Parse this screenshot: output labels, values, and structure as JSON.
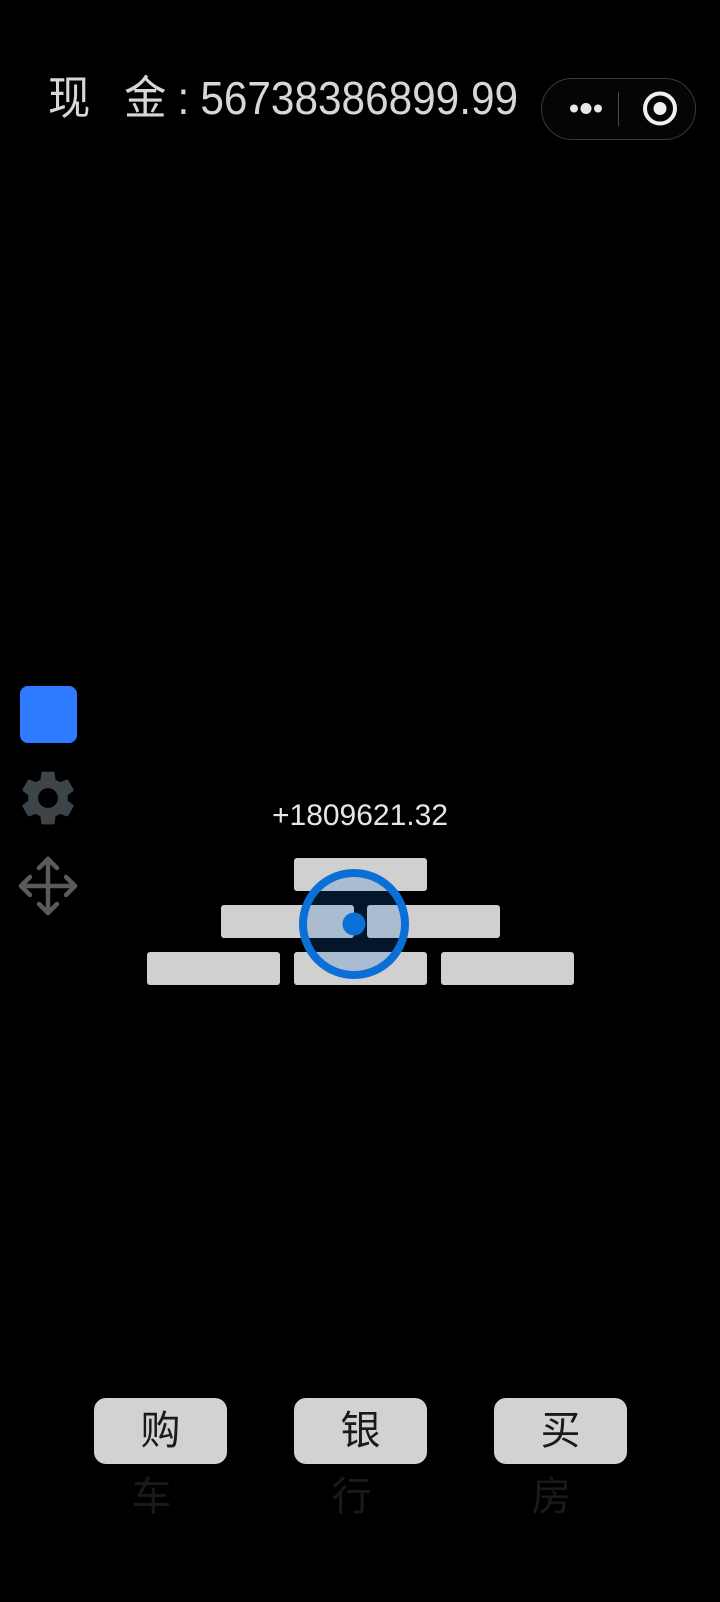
{
  "header": {
    "cash_label": "现 金:",
    "cash_value": "56738386899.99"
  },
  "capsule": {
    "more_icon": "more-dots-icon",
    "close_icon": "target-circle-icon"
  },
  "side_tools": {
    "color_swatch": "#2f7bff",
    "settings_icon": "gear-icon",
    "move_icon": "move-arrows-icon"
  },
  "game": {
    "gain_text": "+1809621.32",
    "brick_color": "#d0d0d0",
    "cursor_color": "#0a6fd6"
  },
  "buttons": {
    "buy_car": "购车",
    "bank": "银行",
    "buy_house": "买房"
  }
}
